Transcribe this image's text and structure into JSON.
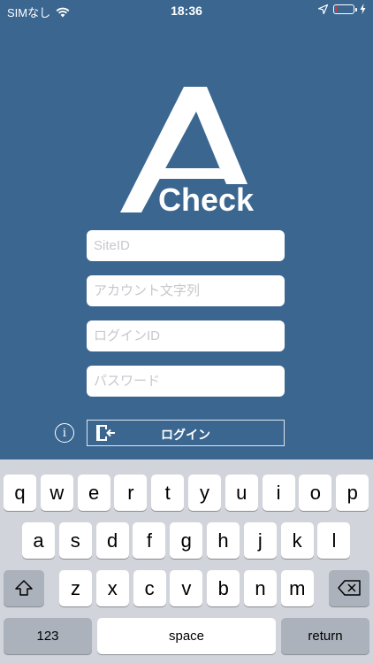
{
  "status_bar": {
    "carrier": "SIMなし",
    "time": "18:36",
    "battery_level": 0.1,
    "battery_color": "#e0342f"
  },
  "app": {
    "logo_text": "Check",
    "background_color": "#3a6690"
  },
  "form": {
    "site_id_placeholder": "SiteID",
    "account_placeholder": "アカウント文字列",
    "login_id_placeholder": "ログインID",
    "password_placeholder": "パスワード",
    "login_label": "ログイン",
    "info_glyph": "i"
  },
  "keyboard": {
    "row1": [
      "q",
      "w",
      "e",
      "r",
      "t",
      "y",
      "u",
      "i",
      "o",
      "p"
    ],
    "row2": [
      "a",
      "s",
      "d",
      "f",
      "g",
      "h",
      "j",
      "k",
      "l"
    ],
    "row3": [
      "z",
      "x",
      "c",
      "v",
      "b",
      "n",
      "m"
    ],
    "numbers_label": "123",
    "space_label": "space",
    "return_label": "return"
  }
}
